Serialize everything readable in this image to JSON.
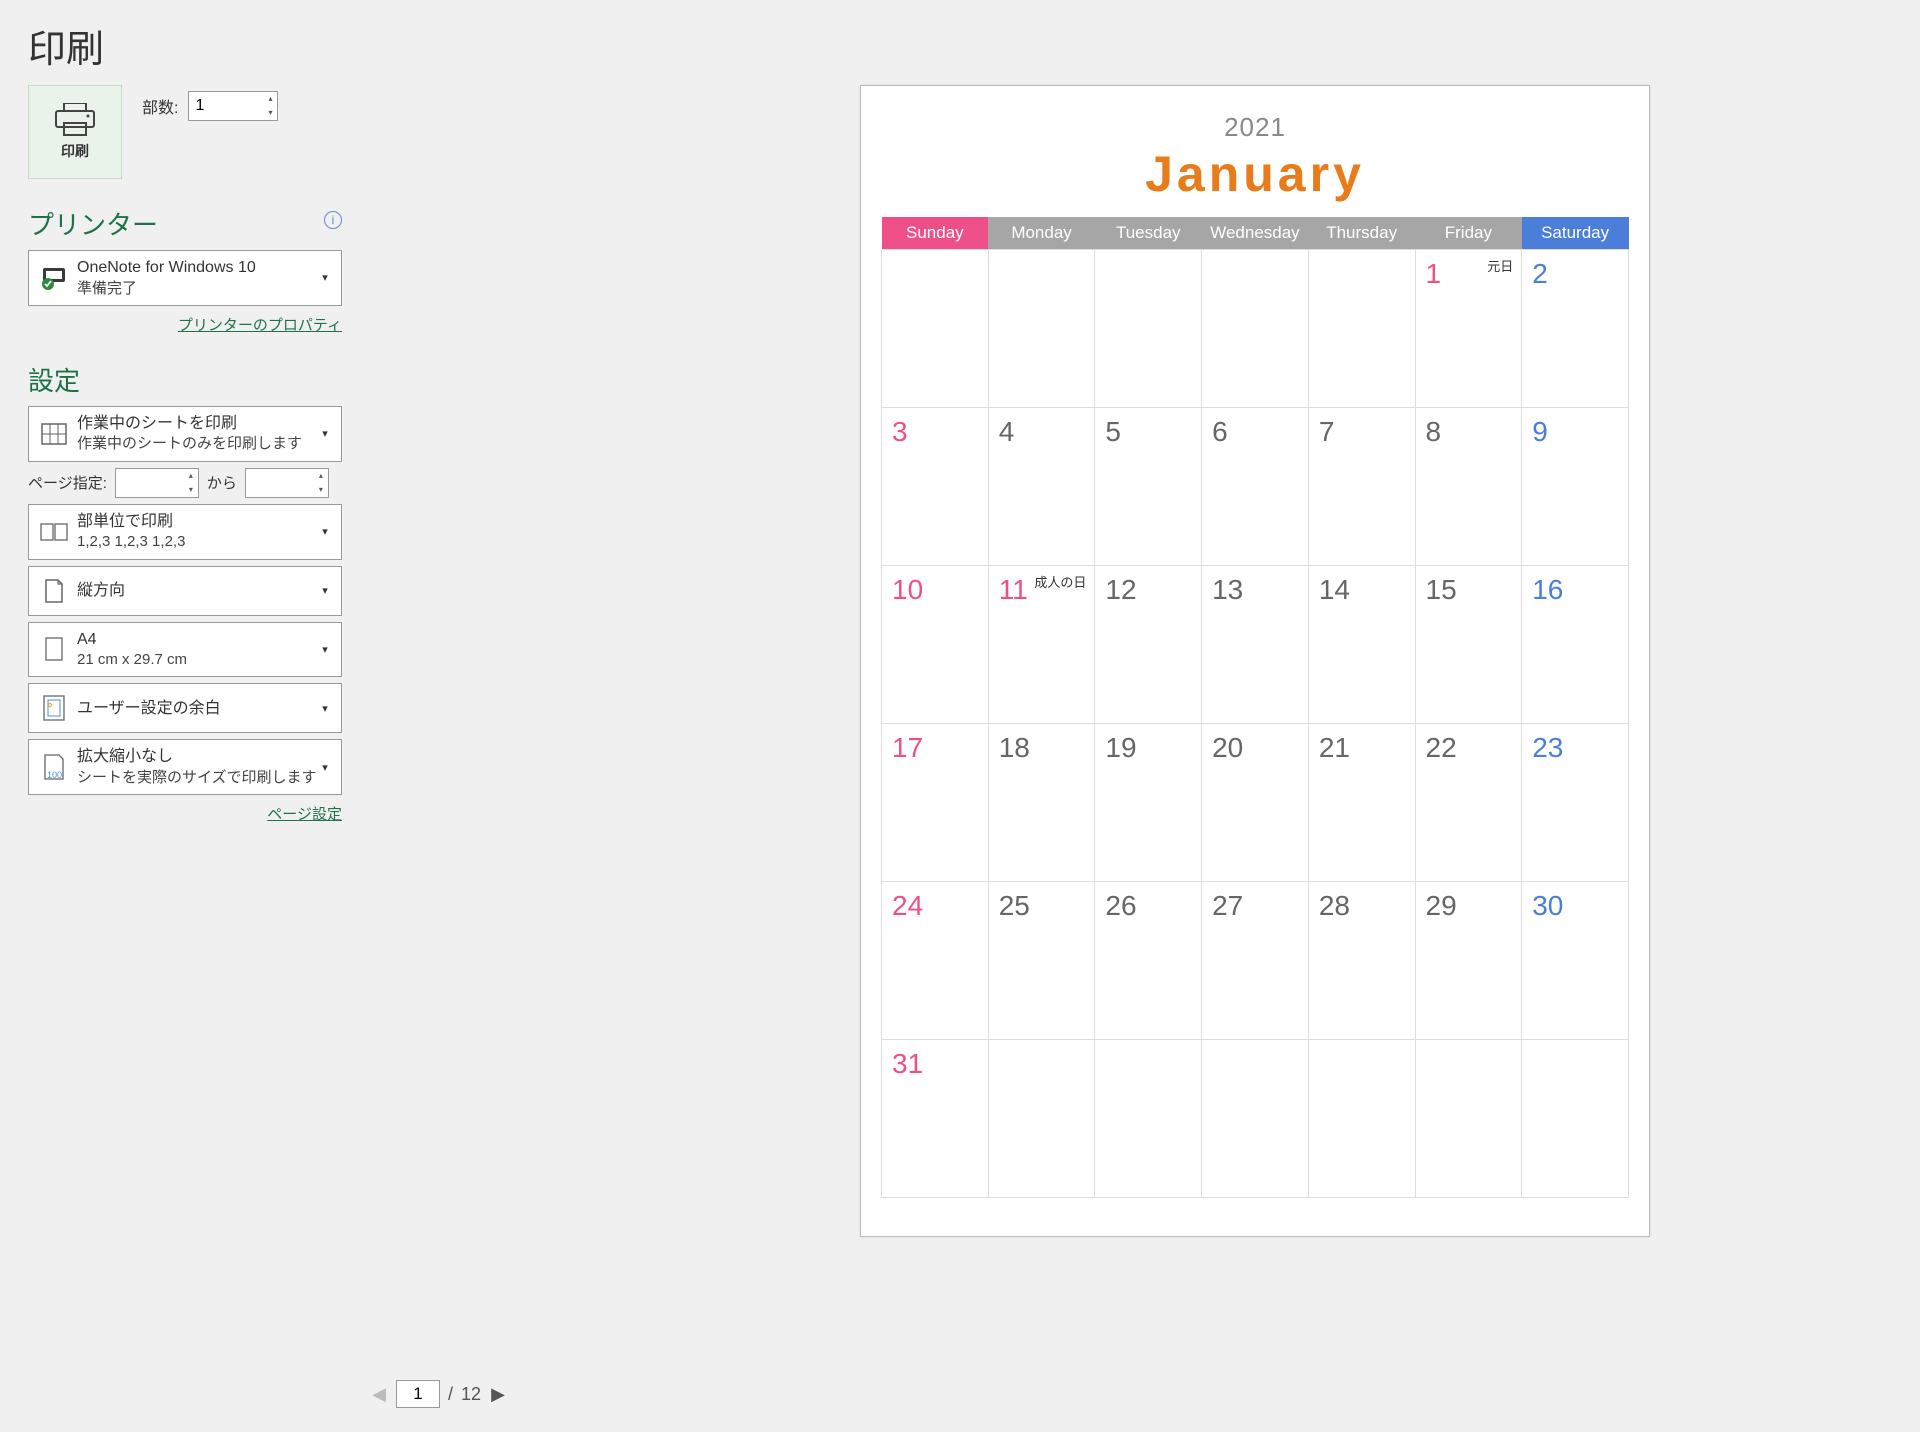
{
  "page_title": "印刷",
  "print_button_label": "印刷",
  "copies": {
    "label": "部数:",
    "value": "1"
  },
  "printer_section": {
    "title": "プリンター",
    "selected": {
      "name": "OneNote for Windows 10",
      "status": "準備完了"
    },
    "properties_link": "プリンターのプロパティ"
  },
  "settings_section": {
    "title": "設定",
    "print_what": {
      "line1": "作業中のシートを印刷",
      "line2": "作業中のシートのみを印刷します"
    },
    "page_range": {
      "label": "ページ指定:",
      "from": "",
      "to_label": "から",
      "to": ""
    },
    "collation": {
      "line1": "部単位で印刷",
      "line2": "1,2,3    1,2,3    1,2,3"
    },
    "orientation": {
      "line1": "縦方向"
    },
    "paper": {
      "line1": "A4",
      "line2": "21 cm x 29.7 cm"
    },
    "margins": {
      "line1": "ユーザー設定の余白"
    },
    "scaling": {
      "line1": "拡大縮小なし",
      "line2": "シートを実際のサイズで印刷します"
    },
    "page_setup_link": "ページ設定"
  },
  "preview": {
    "year": "2021",
    "month": "January",
    "weekdays": [
      "Sunday",
      "Monday",
      "Tuesday",
      "Wednesday",
      "Thursday",
      "Friday",
      "Saturday"
    ],
    "rows": [
      [
        {
          "n": ""
        },
        {
          "n": ""
        },
        {
          "n": ""
        },
        {
          "n": ""
        },
        {
          "n": ""
        },
        {
          "n": "1",
          "holiday": "元日"
        },
        {
          "n": "2"
        }
      ],
      [
        {
          "n": "3"
        },
        {
          "n": "4"
        },
        {
          "n": "5"
        },
        {
          "n": "6"
        },
        {
          "n": "7"
        },
        {
          "n": "8"
        },
        {
          "n": "9"
        }
      ],
      [
        {
          "n": "10"
        },
        {
          "n": "11",
          "holiday": "成人の日"
        },
        {
          "n": "12"
        },
        {
          "n": "13"
        },
        {
          "n": "14"
        },
        {
          "n": "15"
        },
        {
          "n": "16"
        }
      ],
      [
        {
          "n": "17"
        },
        {
          "n": "18"
        },
        {
          "n": "19"
        },
        {
          "n": "20"
        },
        {
          "n": "21"
        },
        {
          "n": "22"
        },
        {
          "n": "23"
        }
      ],
      [
        {
          "n": "24"
        },
        {
          "n": "25"
        },
        {
          "n": "26"
        },
        {
          "n": "27"
        },
        {
          "n": "28"
        },
        {
          "n": "29"
        },
        {
          "n": "30"
        }
      ],
      [
        {
          "n": "31"
        },
        {
          "n": ""
        },
        {
          "n": ""
        },
        {
          "n": ""
        },
        {
          "n": ""
        },
        {
          "n": ""
        },
        {
          "n": ""
        }
      ]
    ]
  },
  "page_nav": {
    "current": "1",
    "total": "12",
    "sep": "/"
  }
}
